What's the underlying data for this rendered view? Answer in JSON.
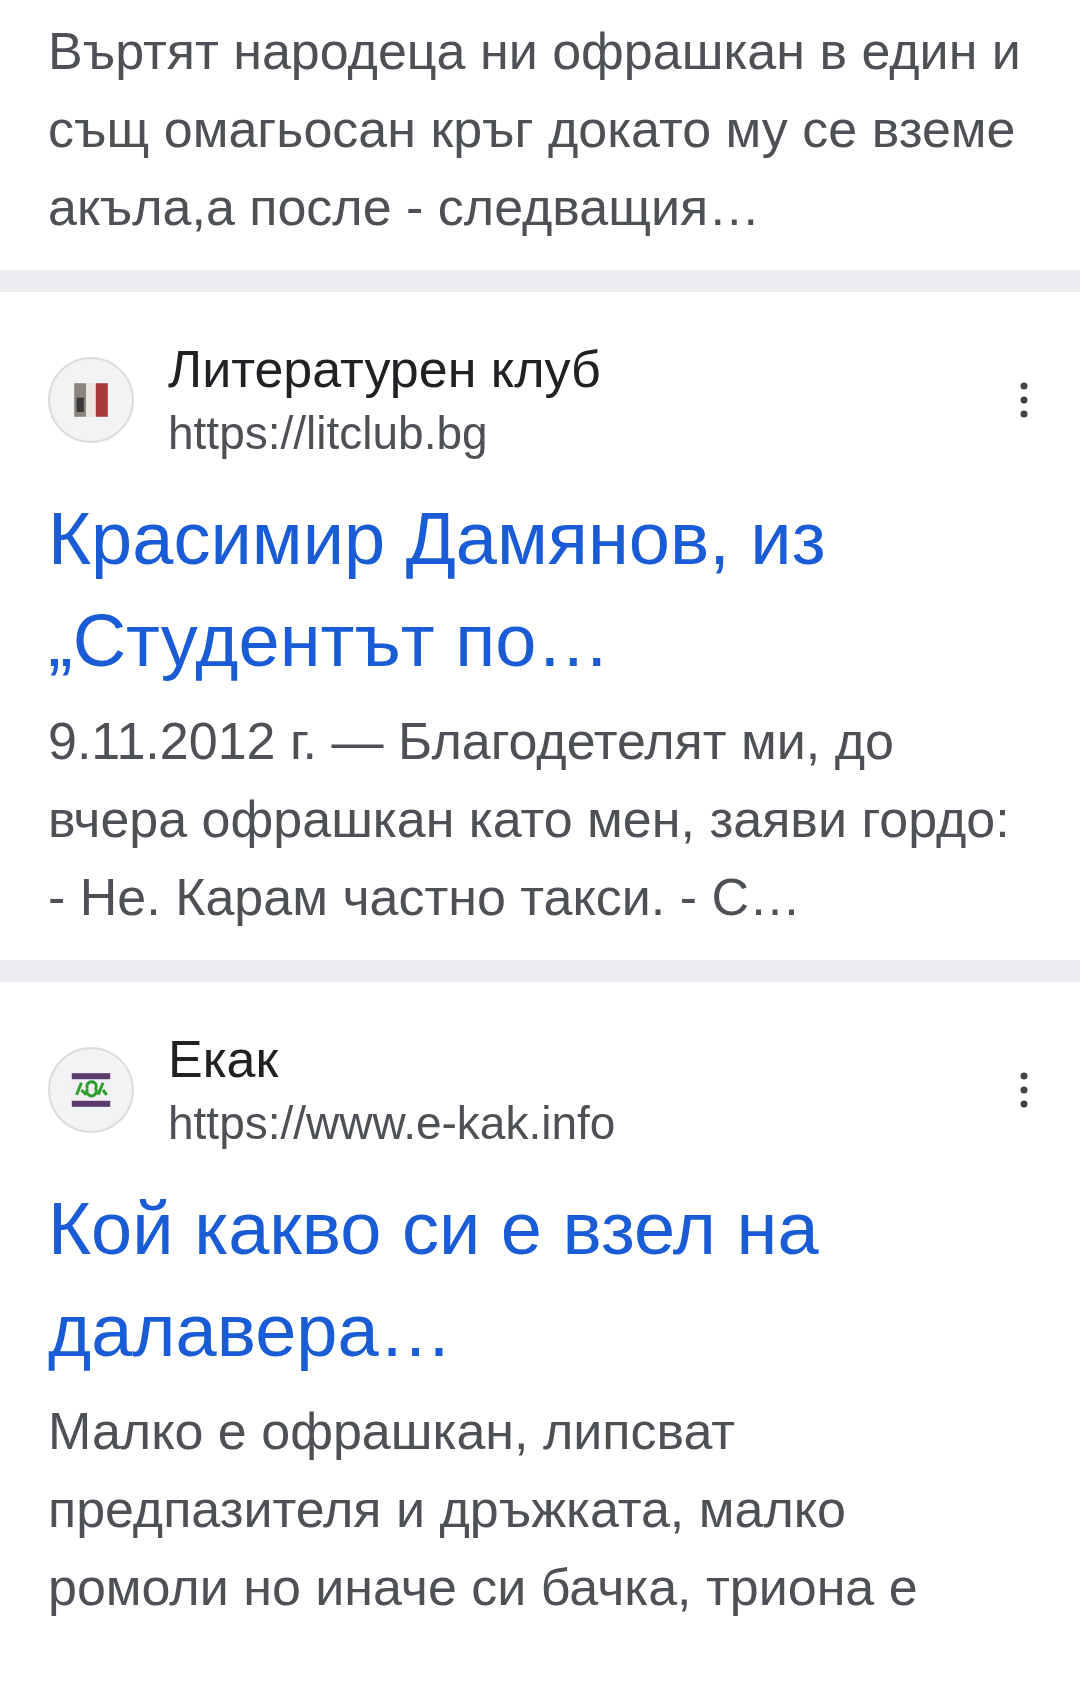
{
  "top_snippet": "Въртят народеца ни офрашкан в един и същ омагьосан кръг докато му се вземе акъла,а после - следващия…",
  "results": [
    {
      "site_name": "Литературен клуб",
      "url": "https://litclub.bg",
      "kind": "stripes",
      "title": "Красимир Дамянов, из „Студентът по…",
      "snippet": "9.11.2012 г. — Благодетелят ми, до вчера офрашкан като мен, заяви гордо: - Не. Карам частно такси. - С…"
    },
    {
      "site_name": "Екак",
      "url": "https://www.e-kak.info",
      "kind": "green",
      "title": "Кой какво си е взел на далавера…",
      "snippet": "Малко е офрашкан, липсват предпазителя и дръжката, малко ромоли но иначе си бачка, триона е"
    }
  ]
}
